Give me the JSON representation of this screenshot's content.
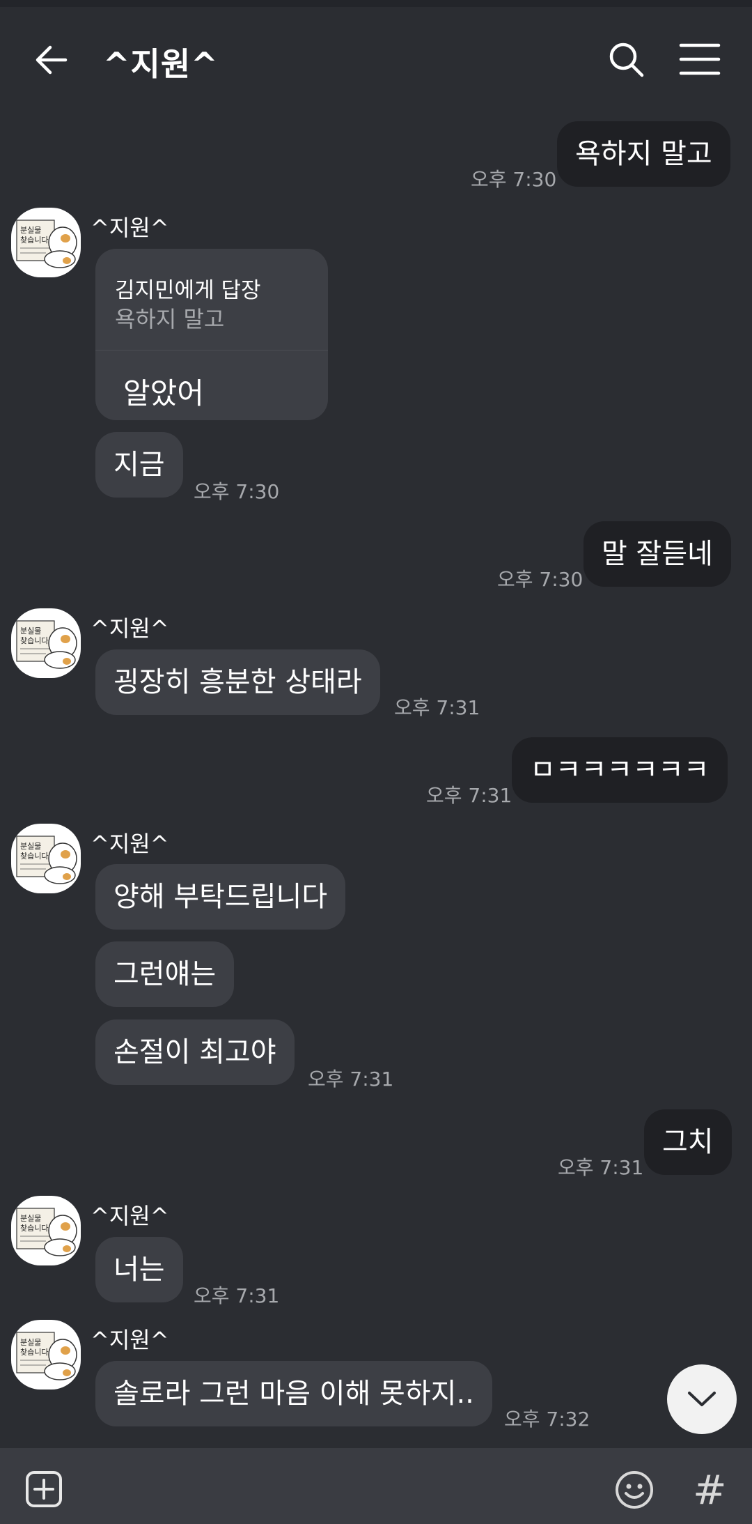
{
  "header": {
    "title": "^지원^"
  },
  "reply_card": {
    "reply_to": "김지민에게 답장",
    "quoted": "욕하지 말고",
    "text": "알았어"
  },
  "messages": [
    {
      "dir": "sent",
      "text": "욕하지 말고",
      "time": "오후 7:30"
    },
    {
      "dir": "recv",
      "sender": "^지원^",
      "text": "지금",
      "time": "오후 7:30"
    },
    {
      "dir": "sent",
      "text": "말 잘듣네",
      "time": "오후 7:30"
    },
    {
      "dir": "recv",
      "sender": "^지원^",
      "text": "굉장히 흥분한 상태라",
      "time": "오후 7:31"
    },
    {
      "dir": "sent",
      "text": "ㅁㅋㅋㅋㅋㅋㅋ",
      "time": "오후 7:31"
    },
    {
      "dir": "recv",
      "sender": "^지원^",
      "text": "양해 부탁드립니다"
    },
    {
      "dir": "recv",
      "text": "그런얘는"
    },
    {
      "dir": "recv",
      "text": "손절이 최고야",
      "time": "오후 7:31"
    },
    {
      "dir": "sent",
      "text": "그치",
      "time": "오후 7:31"
    },
    {
      "dir": "recv",
      "sender": "^지원^",
      "text": "너는",
      "time": "오후 7:31"
    },
    {
      "dir": "recv",
      "sender": "^지원^",
      "text": "솔로라 그런 마음 이해 못하지..",
      "time": "오후 7:32"
    }
  ],
  "avatar": {
    "line1": "분실물",
    "line2": "찾습니다"
  },
  "toolbar": {
    "hash": "#"
  },
  "colors": {
    "background": "#2b2d32",
    "received_bubble": "#3d3f45",
    "sent_bubble": "#1f2024",
    "timestamp": "#a7a9ad"
  }
}
